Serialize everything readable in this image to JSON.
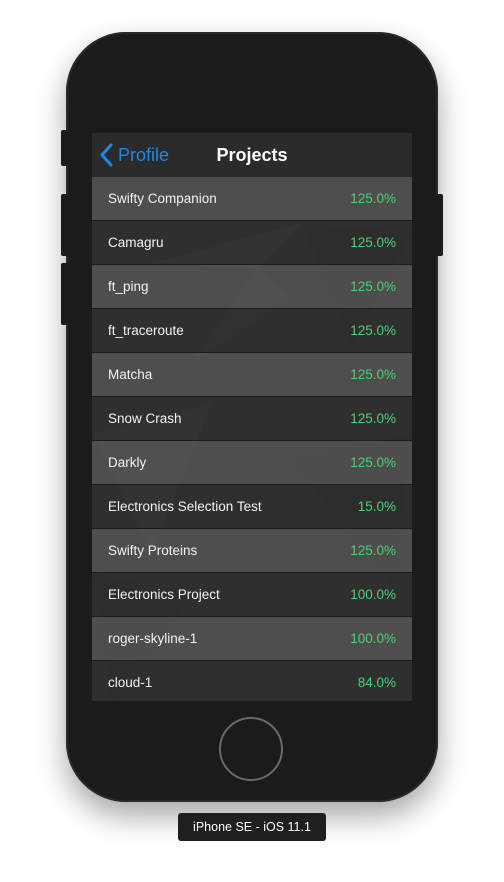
{
  "navbar": {
    "back_label": "Profile",
    "title": "Projects"
  },
  "projects": [
    {
      "name": "Swifty Companion",
      "score": "125.0%"
    },
    {
      "name": "Camagru",
      "score": "125.0%"
    },
    {
      "name": "ft_ping",
      "score": "125.0%"
    },
    {
      "name": "ft_traceroute",
      "score": "125.0%"
    },
    {
      "name": "Matcha",
      "score": "125.0%"
    },
    {
      "name": "Snow Crash",
      "score": "125.0%"
    },
    {
      "name": "Darkly",
      "score": "125.0%"
    },
    {
      "name": "Electronics Selection Test",
      "score": "15.0%"
    },
    {
      "name": "Swifty Proteins",
      "score": "125.0%"
    },
    {
      "name": "Electronics Project",
      "score": "100.0%"
    },
    {
      "name": "roger-skyline-1",
      "score": "100.0%"
    },
    {
      "name": "cloud-1",
      "score": "84.0%"
    }
  ],
  "device": {
    "label": "iPhone SE - iOS 11.1"
  },
  "colors": {
    "accent": "#1e88e5",
    "score": "#4cd077",
    "phone_body": "#1b1b1b"
  },
  "icons": {
    "back": "chevron-left-icon"
  }
}
